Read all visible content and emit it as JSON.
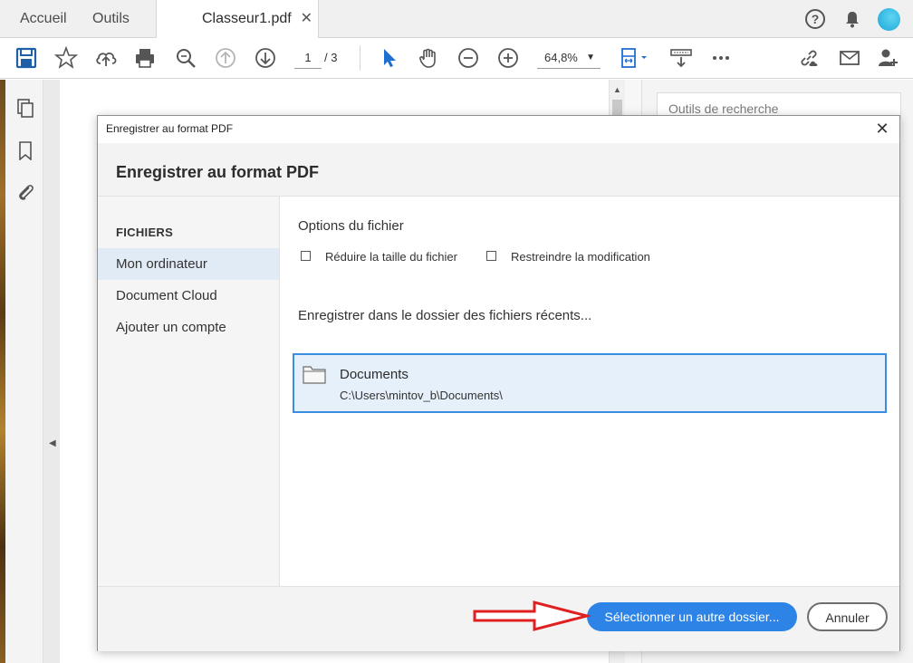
{
  "tabs": {
    "home": "Accueil",
    "tools": "Outils",
    "document": "Classeur1.pdf",
    "close": "✕"
  },
  "top_icons": [
    "help-icon",
    "bell-icon",
    "avatar"
  ],
  "toolbar": {
    "icons": [
      "save-icon",
      "star-icon",
      "cloud-upload-icon",
      "print-icon",
      "zoom-search-icon",
      "page-up-icon",
      "page-down-icon",
      "select-pointer-icon",
      "hand-icon",
      "zoom-out-icon",
      "zoom-in-icon",
      "page-fit-icon",
      "scroll-mode-icon",
      "more-icon",
      "share-link-icon",
      "email-icon",
      "add-user-icon"
    ],
    "page_current": "1",
    "page_total": "/ 3",
    "zoom": "64,8%"
  },
  "left_nav": [
    "pages-icon",
    "bookmark-icon",
    "attachment-icon"
  ],
  "right_pane": {
    "search_tools": "Outils de recherche"
  },
  "dialog": {
    "window_title": "Enregistrer au format PDF",
    "heading": "Enregistrer au format PDF",
    "close": "✕",
    "sidebar": {
      "heading": "FICHIERS",
      "items": [
        {
          "label": "Mon ordinateur",
          "active": true
        },
        {
          "label": "Document Cloud",
          "active": false
        },
        {
          "label": "Ajouter un compte",
          "active": false
        }
      ]
    },
    "main": {
      "options_title": "Options du fichier",
      "option_reduce": "Réduire la taille du fichier",
      "option_restrict": "Restreindre la modification",
      "recent_title": "Enregistrer dans le dossier des fichiers récents...",
      "folder": {
        "name": "Documents",
        "path": "C:\\Users\\mintov_b\\Documents\\"
      }
    },
    "footer": {
      "select_folder": "Sélectionner un autre dossier...",
      "cancel": "Annuler"
    }
  },
  "colors": {
    "accent": "#2d84e6",
    "selected_bg": "#e6f0fa",
    "annotation_arrow": "#e02020"
  }
}
